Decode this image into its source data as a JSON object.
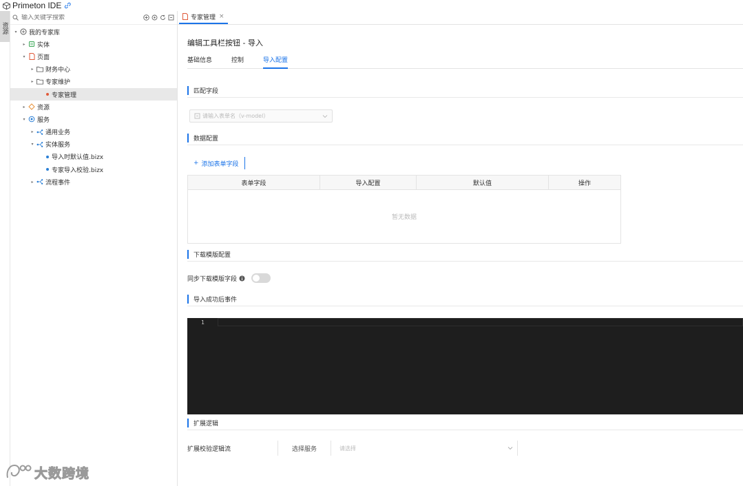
{
  "app": {
    "title": "Primeton IDE"
  },
  "side_strip": {
    "tab_label": "资源"
  },
  "tree": {
    "search_placeholder": "输入关键字搜索",
    "nodes": [
      {
        "label": "我的专家库",
        "level": 0,
        "caret": "▾",
        "icon": "database-icon",
        "selected": false
      },
      {
        "label": "实体",
        "level": 1,
        "caret": "▸",
        "icon": "entity-icon",
        "selected": false
      },
      {
        "label": "页面",
        "level": 1,
        "caret": "▾",
        "icon": "page-icon",
        "selected": false
      },
      {
        "label": "财务中心",
        "level": 2,
        "caret": "▸",
        "icon": "folder-icon",
        "selected": false
      },
      {
        "label": "专家维护",
        "level": 2,
        "caret": "▸",
        "icon": "folder-icon",
        "selected": false
      },
      {
        "label": "专家管理",
        "level": 3,
        "caret": "",
        "icon": "page-dot-icon",
        "selected": true
      },
      {
        "label": "资源",
        "level": 1,
        "caret": "▸",
        "icon": "resource-icon",
        "selected": false
      },
      {
        "label": "服务",
        "level": 1,
        "caret": "▾",
        "icon": "service-icon",
        "selected": false
      },
      {
        "label": "通用业务",
        "level": 2,
        "caret": "▸",
        "icon": "flow-icon",
        "selected": false
      },
      {
        "label": "实体服务",
        "level": 2,
        "caret": "▾",
        "icon": "flow-icon",
        "selected": false
      },
      {
        "label": "导入时默认值.bizx",
        "level": 3,
        "caret": "",
        "icon": "bizx-dot-icon",
        "selected": false
      },
      {
        "label": "专家导入校验.bizx",
        "level": 3,
        "caret": "",
        "icon": "bizx-dot-icon",
        "selected": false
      },
      {
        "label": "流程事件",
        "level": 2,
        "caret": "▸",
        "icon": "flow-icon",
        "selected": false
      }
    ]
  },
  "editor_tab": {
    "label": "专家管理",
    "close": "×"
  },
  "main": {
    "title": "编辑工具栏按钮 - 导入",
    "subtabs": [
      {
        "label": "基础信息",
        "active": false
      },
      {
        "label": "控制",
        "active": false
      },
      {
        "label": "导入配置",
        "active": true
      }
    ],
    "section_match": "匹配字段",
    "match_placeholder": "请输入表单名（v-model）",
    "section_data": "数据配置",
    "add_field_button": "添加表单字段",
    "table_headers": [
      "表单字段",
      "导入配置",
      "默认值",
      "操作"
    ],
    "table_empty": "暂无数据",
    "section_download": "下载模版配置",
    "toggle_label": "同步下载模版字段",
    "toggle_on": false,
    "section_success": "导入成功后事件",
    "editor_line_number": "1",
    "section_extend": "扩展逻辑",
    "extend_label": "扩展校验逻辑流",
    "select_service": "选择服务",
    "select_placeholder": "请选择"
  },
  "watermark": {
    "text": "大数跨境"
  },
  "colors": {
    "accent": "#1a73e8",
    "editor_bg": "#1e1e1e",
    "selected_row": "#e8e8e8"
  }
}
